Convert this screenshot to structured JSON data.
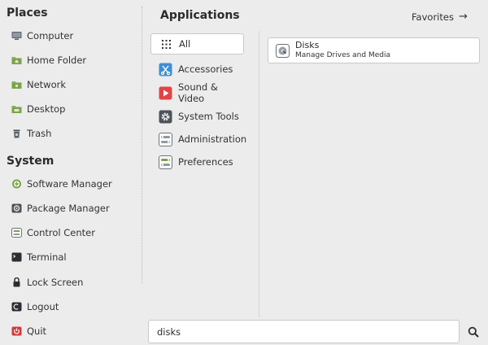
{
  "places": {
    "title": "Places",
    "items": [
      {
        "label": "Computer",
        "icon": "computer-icon"
      },
      {
        "label": "Home Folder",
        "icon": "home-folder-icon"
      },
      {
        "label": "Network",
        "icon": "network-folder-icon"
      },
      {
        "label": "Desktop",
        "icon": "desktop-folder-icon"
      },
      {
        "label": "Trash",
        "icon": "trash-icon"
      }
    ]
  },
  "system": {
    "title": "System",
    "items": [
      {
        "label": "Software Manager",
        "icon": "software-manager-icon"
      },
      {
        "label": "Package Manager",
        "icon": "package-manager-icon"
      },
      {
        "label": "Control Center",
        "icon": "control-center-icon"
      },
      {
        "label": "Terminal",
        "icon": "terminal-icon"
      },
      {
        "label": "Lock Screen",
        "icon": "lock-icon"
      },
      {
        "label": "Logout",
        "icon": "logout-icon"
      },
      {
        "label": "Quit",
        "icon": "power-icon"
      }
    ]
  },
  "applications": {
    "title": "Applications",
    "favorites_label": "Favorites",
    "categories": [
      {
        "label": "All",
        "icon": "grid-icon",
        "selected": true
      },
      {
        "label": "Accessories",
        "icon": "accessories-icon"
      },
      {
        "label": "Sound & Video",
        "icon": "media-play-icon"
      },
      {
        "label": "System Tools",
        "icon": "gear-icon"
      },
      {
        "label": "Administration",
        "icon": "administration-icon"
      },
      {
        "label": "Preferences",
        "icon": "preferences-icon"
      }
    ],
    "results": [
      {
        "name": "Disks",
        "description": "Manage Drives and Media",
        "icon": "disk-icon"
      }
    ]
  },
  "search": {
    "value": "disks"
  },
  "colors": {
    "background": "#ececec",
    "folder_green": "#8bb158",
    "accessories_blue": "#3d8fd6",
    "media_red": "#e04545",
    "power_red": "#d33b3b"
  }
}
